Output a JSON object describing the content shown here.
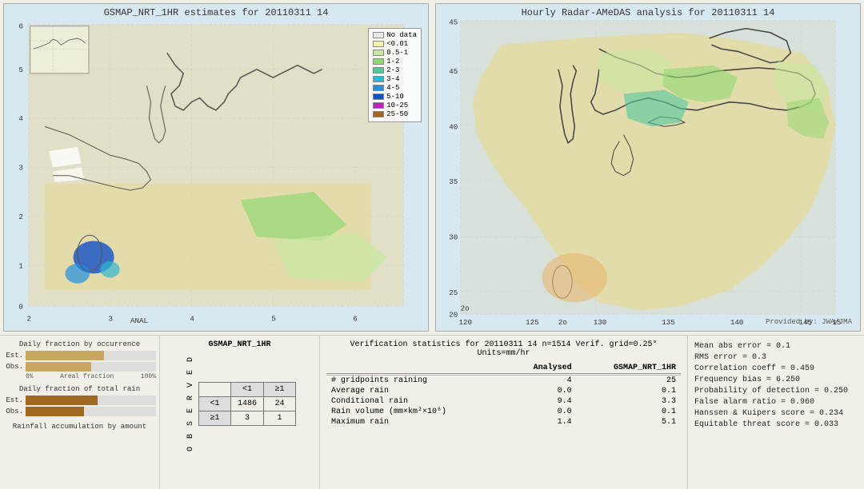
{
  "left_map": {
    "title": "GSMAP_NRT_1HR estimates for 20110311 14",
    "corner_label": "GSMAP_NRT_1HR",
    "anal_label": "ANAL",
    "lat_labels": [
      "6",
      "5",
      "4",
      "3",
      "2",
      "1",
      "0"
    ],
    "lon_labels": [
      "2",
      "3",
      "4",
      "5",
      "6"
    ]
  },
  "right_map": {
    "title": "Hourly Radar-AMeDAS analysis for 20110311 14",
    "lat_labels": [
      "45",
      "40",
      "35",
      "30",
      "25",
      "20"
    ],
    "lon_labels": [
      "120",
      "125",
      "130",
      "135",
      "140",
      "145"
    ],
    "provided_by": "Provided by: JWA/JMA"
  },
  "legend": {
    "items": [
      {
        "label": "No data",
        "color": "#e8e8e8"
      },
      {
        "label": "<0.01",
        "color": "#f5f5b0"
      },
      {
        "label": "0.5-1",
        "color": "#c8e8a0"
      },
      {
        "label": "1-2",
        "color": "#90d870"
      },
      {
        "label": "2-3",
        "color": "#50c8a0"
      },
      {
        "label": "3-4",
        "color": "#30b8d0"
      },
      {
        "label": "4-5",
        "color": "#2090e0"
      },
      {
        "label": "5-10",
        "color": "#1050c8"
      },
      {
        "label": "10-25",
        "color": "#c020c0"
      },
      {
        "label": "25-50",
        "color": "#a06820"
      }
    ]
  },
  "bar_charts": {
    "title1": "Daily fraction by occurrence",
    "est_label": "Est.",
    "obs_label": "Obs.",
    "axis_start": "0%",
    "axis_end": "100%",
    "axis_mid": "Areal fraction",
    "title2": "Daily fraction of total rain",
    "est_bar1": 60,
    "obs_bar1": 50,
    "est_bar2": 55,
    "obs_bar2": 45,
    "footer": "Rainfall accumulation by amount"
  },
  "contingency": {
    "title": "GSMAP_NRT_1HR",
    "header_lt1": "<1",
    "header_ge1": "≥1",
    "obs_lt1": "<1",
    "obs_ge1": "≥1",
    "val_a": "1486",
    "val_b": "24",
    "val_c": "3",
    "val_d": "1",
    "obs_label": "O B S E R V E D"
  },
  "verification": {
    "title": "Verification statistics for 20110311 14  n=1514  Verif. grid=0.25°  Units=mm/hr",
    "col_header1": "Analysed",
    "col_header2": "GSMAP_NRT_1HR",
    "rows": [
      {
        "label": "# gridpoints raining",
        "val1": "4",
        "val2": "25"
      },
      {
        "label": "Average rain",
        "val1": "0.0",
        "val2": "0.1"
      },
      {
        "label": "Conditional rain",
        "val1": "9.4",
        "val2": "3.3"
      },
      {
        "label": "Rain volume (mm×km²×10⁶)",
        "val1": "0.0",
        "val2": "0.1"
      },
      {
        "label": "Maximum rain",
        "val1": "1.4",
        "val2": "5.1"
      }
    ]
  },
  "stats": {
    "mean_abs_error": "Mean abs error = 0.1",
    "rms_error": "RMS error = 0.3",
    "correlation": "Correlation coeff = 0.459",
    "freq_bias": "Frequency bias = 6.250",
    "prob_detection": "Probability of detection = 0.250",
    "false_alarm": "False alarm ratio = 0.960",
    "hanssen_kuipers": "Hanssen & Kuipers score = 0.234",
    "equitable_threat": "Equitable threat score = 0.033"
  }
}
